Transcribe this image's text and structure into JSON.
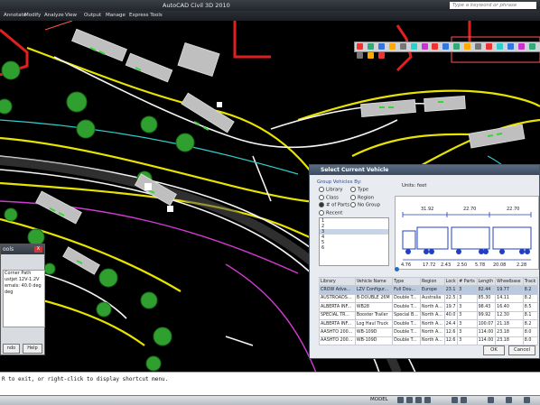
{
  "window": {
    "title": "AutoCAD Civil 3D 2010",
    "search_placeholder": "Type a keyword or phrase"
  },
  "menu": {
    "items": [
      "Annotate",
      "Modify",
      "Analyze",
      "View",
      "Output",
      "Manage",
      "Express Tools"
    ]
  },
  "left_panel": {
    "title": "ools",
    "close": "X",
    "lines": [
      "",
      "Corner Path",
      "ustjet 12V-1.2V",
      "ernals: 40.0 deg",
      "",
      "",
      "",
      "",
      "deg"
    ],
    "buttons": [
      "ndo",
      "Help"
    ]
  },
  "dialog": {
    "title": "Select Current Vehicle",
    "group_label": "Group Vehicles By:",
    "radios": [
      {
        "label": "Library",
        "checked": false
      },
      {
        "label": "Type",
        "checked": false
      },
      {
        "label": "Class",
        "checked": false
      },
      {
        "label": "Region",
        "checked": false
      },
      {
        "label": "# of Parts",
        "checked": true
      },
      {
        "label": "No Group",
        "checked": false
      },
      {
        "label": "Recent",
        "checked": false
      }
    ],
    "groups": [
      "1",
      "2",
      "3",
      "4",
      "5",
      "6"
    ],
    "selected_group": "3",
    "units_label": "Units: feet",
    "dimension_top": [
      "31.92",
      "22.70",
      "22.70"
    ],
    "dimension_bottom": [
      "4.76",
      "17.72",
      "2.43",
      "2.50",
      "5.78",
      "20.08",
      "2.28"
    ],
    "table": {
      "headers": [
        "Library",
        "Vehicle Name",
        "Type",
        "Region",
        "Lock",
        "# Parts",
        "Length",
        "Wheelbase",
        "Track"
      ],
      "rows": [
        [
          "CROW Adva...",
          "LZV Configur...",
          "Full Dou...",
          "Europe",
          "23.1",
          "3",
          "82.44",
          "19.77",
          "8.2"
        ],
        [
          "AUSTROADS...",
          "B-DOUBLE 26M",
          "Double T...",
          "Australia",
          "22.5",
          "3",
          "85.30",
          "14.11",
          "8.2"
        ],
        [
          "ALBERTA INF...",
          "WB28",
          "Double T...",
          "North A...",
          "19.7",
          "3",
          "98.43",
          "16.40",
          "8.5"
        ],
        [
          "SPECIAL TR...",
          "Booster Trailer",
          "Special B...",
          "North A...",
          "40.0",
          "3",
          "99.92",
          "12.30",
          "8.1"
        ],
        [
          "ALBERTA INF...",
          "Log Haul Truck",
          "Double T...",
          "North A...",
          "24.4",
          "3",
          "100.07",
          "21.18",
          "8.2"
        ],
        [
          "AASHTO 200...",
          "WB-109D",
          "Double T...",
          "North A...",
          "12.6",
          "3",
          "114.00",
          "23.18",
          "8.0"
        ],
        [
          "AASHTO 200...",
          "WB-109D",
          "Double T...",
          "North A...",
          "12.6",
          "3",
          "114.00",
          "23.18",
          "8.0"
        ]
      ],
      "selected_row": 0
    },
    "ok": "OK",
    "cancel": "Cancel"
  },
  "command_line": {
    "text": "R to exit, or right-click to display shortcut menu."
  },
  "status": {
    "model": "MODEL"
  }
}
